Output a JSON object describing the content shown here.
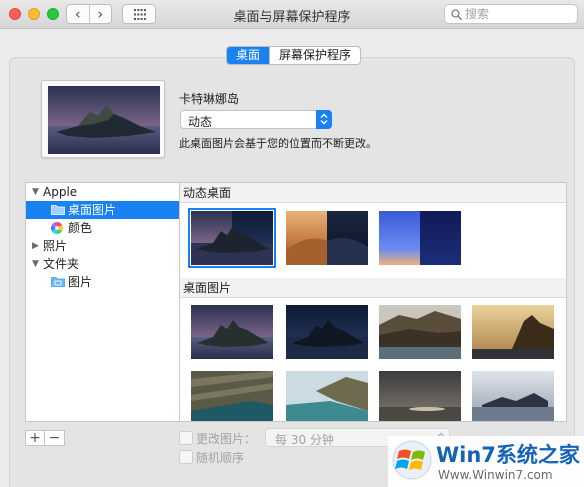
{
  "window": {
    "title": "桌面与屏幕保护程序",
    "search_placeholder": "搜索"
  },
  "tabs": [
    {
      "label": "桌面",
      "selected": true
    },
    {
      "label": "屏幕保护程序",
      "selected": false
    }
  ],
  "current_wallpaper": {
    "name": "卡特琳娜岛",
    "mode_selected": "动态",
    "description": "此桌面图片会基于您的位置而不断更改。"
  },
  "sidebar": {
    "groups": [
      {
        "label": "Apple",
        "expanded": true
      },
      {
        "label": "照片",
        "expanded": false
      },
      {
        "label": "文件夹",
        "expanded": true
      }
    ],
    "items": [
      {
        "label": "桌面图片",
        "selected": true
      },
      {
        "label": "颜色",
        "selected": false
      },
      {
        "label": "图片",
        "selected": false
      }
    ]
  },
  "sections": {
    "dynamic": "动态桌面",
    "pictures": "桌面图片"
  },
  "bottom": {
    "add_label": "+",
    "remove_label": "−",
    "change_picture_label": "更改图片：",
    "change_interval": "每 30 分钟",
    "random_order_label": "随机顺序",
    "change_picture_checked": false,
    "random_order_checked": false
  },
  "watermark": {
    "brand": "Win7系统之家",
    "url": "Www.Winwin7.com"
  },
  "colors": {
    "accent": "#1a81f0",
    "window_bg": "#ececec",
    "panel_bg": "#e4e4e4"
  }
}
